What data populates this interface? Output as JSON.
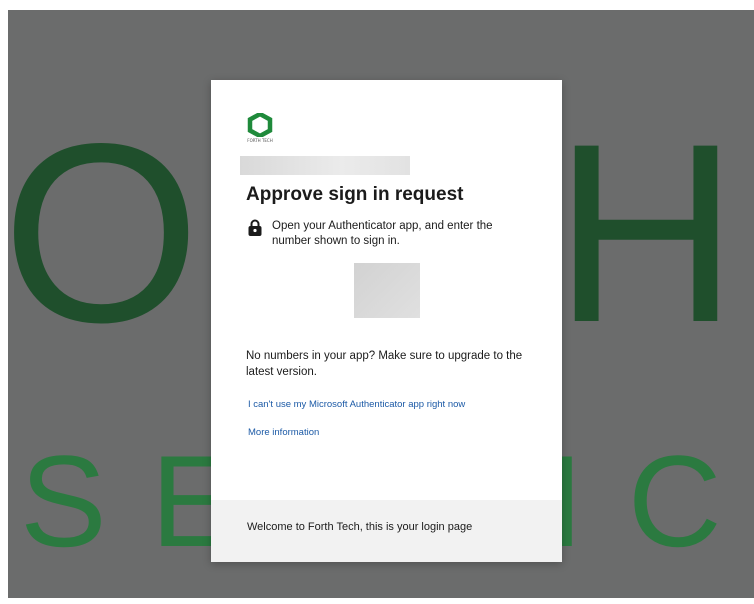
{
  "background": {
    "top_word": "OFTH",
    "bottom_word": "SERVICES"
  },
  "brand": {
    "logo_icon": "forth-tech-hexagon-logo-icon",
    "logo_caption": "FORTH TECH",
    "accent_color": "#1f8a3b"
  },
  "dialog": {
    "title": "Approve sign in request",
    "instruction_icon": "lock-icon",
    "instruction": "Open your Authenticator app, and enter the number shown to sign in.",
    "no_numbers_text": "No numbers in your app? Make sure to upgrade to the latest version.",
    "links": {
      "cant_use": "I can't use my Microsoft Authenticator app right now",
      "more_info": "More information"
    },
    "link_color": "#1c5aa6"
  },
  "footer": {
    "text": "Welcome to Forth Tech, this is your login page"
  }
}
